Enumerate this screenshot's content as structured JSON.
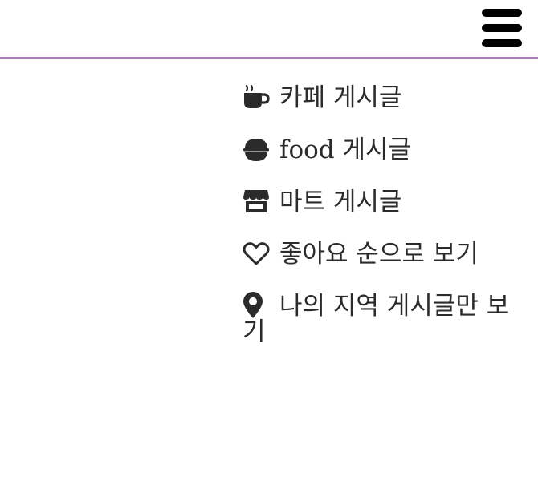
{
  "header": {
    "menu_icon": "hamburger-icon"
  },
  "menu": {
    "items": [
      {
        "icon": "coffee-cup-icon",
        "label": "카페 게시글"
      },
      {
        "icon": "rice-bowl-icon",
        "label": "food 게시글"
      },
      {
        "icon": "store-icon",
        "label": "마트 게시글"
      },
      {
        "icon": "heart-outline-icon",
        "label": "좋아요 순으로 보기"
      },
      {
        "icon": "map-pin-icon",
        "label": "나의 지역 게시글만 보기"
      }
    ]
  },
  "colors": {
    "divider": "#b07cc0",
    "text": "#2b2b2b",
    "icon": "#2b2b2b",
    "hamburger": "#000000"
  }
}
